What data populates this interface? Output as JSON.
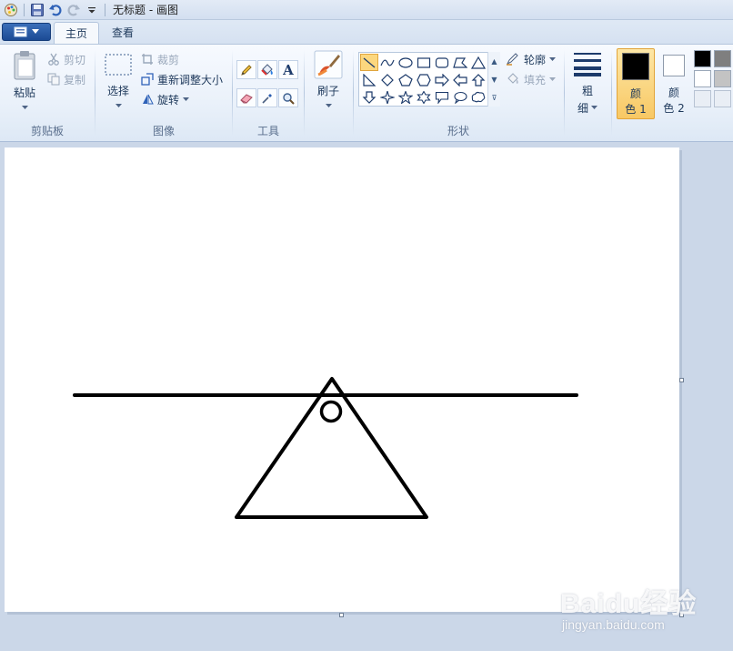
{
  "window": {
    "title": "无标题 - 画图"
  },
  "quick_access": {
    "icons": [
      "paint-app-icon",
      "save-icon",
      "undo-icon",
      "redo-icon",
      "customize-dropdown-icon"
    ]
  },
  "ribbon_tabs": [
    {
      "label": "主页",
      "active": true
    },
    {
      "label": "查看",
      "active": false
    }
  ],
  "clipboard": {
    "paste_label": "粘贴",
    "cut_label": "剪切",
    "copy_label": "复制",
    "group_label": "剪贴板"
  },
  "image": {
    "select_label": "选择",
    "crop_label": "裁剪",
    "resize_label": "重新调整大小",
    "rotate_label": "旋转",
    "group_label": "图像"
  },
  "tools": {
    "items": [
      "pencil-icon",
      "fill-icon",
      "text-icon",
      "eraser-icon",
      "color-picker-icon",
      "magnifier-icon"
    ],
    "text_glyph": "A",
    "group_label": "工具"
  },
  "brushes": {
    "label": "刷子"
  },
  "shapes": {
    "outline_label": "轮廓",
    "fill_label": "填充",
    "group_label": "形状",
    "selected": "line"
  },
  "size": {
    "label_top": "粗",
    "label_bottom": "细"
  },
  "colors": {
    "color1_top": "颜",
    "color1_bottom": "色 1",
    "color1_value": "#000000",
    "color2_top": "颜",
    "color2_bottom": "色 2",
    "color2_value": "#ffffff",
    "palette": [
      "#000000",
      "#7f7f7f",
      "#ffffff",
      "#c3c3c3"
    ],
    "accent_selected": "#f8c864"
  },
  "drawing": {
    "stroke_color": "#000000",
    "description_shapes": [
      "horizontal-line",
      "triangle",
      "small-circle"
    ]
  },
  "watermark": {
    "brand": "Baidu经验",
    "url": "jingyan.baidu.com"
  }
}
